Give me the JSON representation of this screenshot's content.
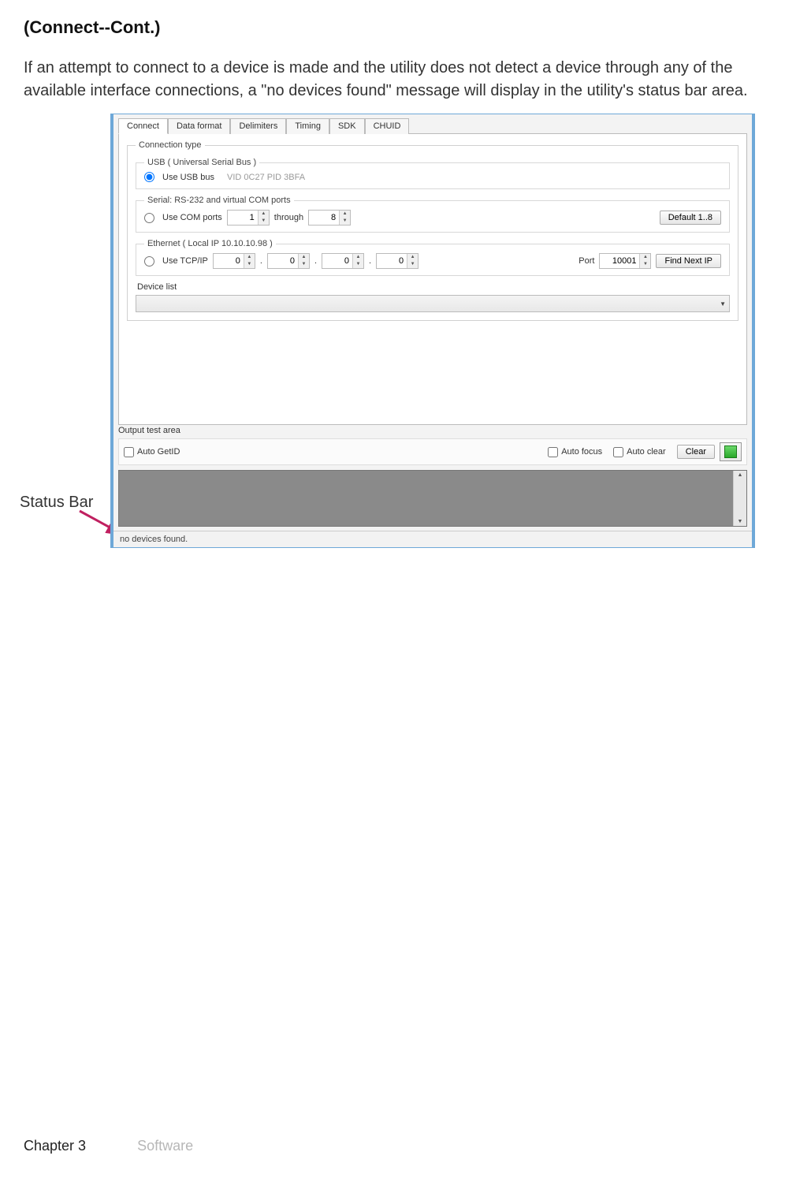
{
  "heading": "(Connect--Cont.)",
  "body_text": "If an attempt to connect to a device is made and the utility does not detect a device through any of the available interface connections, a \"no devices found\" message will display in the utility's status bar area.",
  "callout_label": "Status Bar",
  "tabs": [
    "Connect",
    "Data format",
    "Delimiters",
    "Timing",
    "SDK",
    "CHUID"
  ],
  "conn_type_legend": "Connection type",
  "usb": {
    "legend": "USB ( Universal Serial Bus )",
    "radio_label": "Use USB bus",
    "hint": "VID 0C27  PID 3BFA"
  },
  "serial": {
    "legend": "Serial: RS-232 and virtual COM ports",
    "radio_label": "Use COM ports",
    "from": "1",
    "through_label": "through",
    "to": "8",
    "button": "Default 1..8"
  },
  "ethernet": {
    "legend": "Ethernet ( Local IP 10.10.10.98 )",
    "radio_label": "Use TCP/IP",
    "oct1": "0",
    "oct2": "0",
    "oct3": "0",
    "oct4": "0",
    "port_label": "Port",
    "port_value": "10001",
    "button": "Find Next IP"
  },
  "device_list_label": "Device list",
  "output": {
    "label": "Output test area",
    "auto_getid": "Auto GetID",
    "auto_focus": "Auto focus",
    "auto_clear": "Auto clear",
    "clear": "Clear"
  },
  "status_message": "no devices found.",
  "footer": {
    "chapter": "Chapter 3",
    "section": "Software"
  }
}
